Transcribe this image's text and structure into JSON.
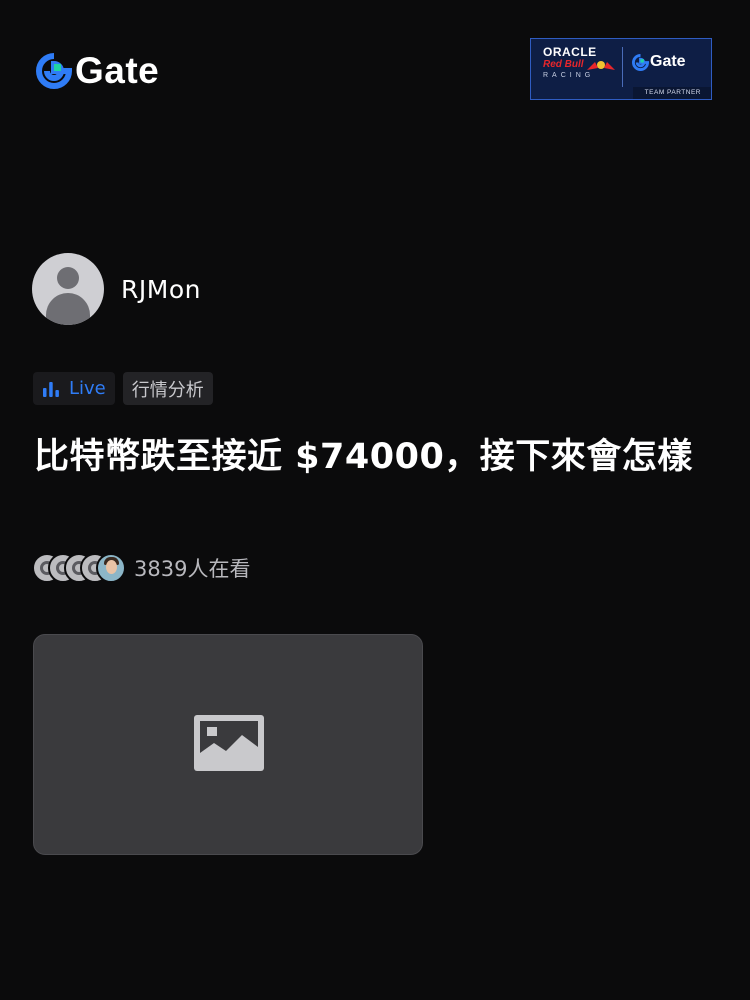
{
  "header": {
    "logo_text": "Gate",
    "brand_color": "#2f7cf6",
    "partner": {
      "line1": "ORACLE",
      "line2": "Red Bull",
      "line3": "RACING",
      "gate_text": "Gate",
      "footer": "TEAM PARTNER"
    }
  },
  "author": {
    "name": "RJMon",
    "avatar_icon": "default-user-avatar"
  },
  "tags": {
    "live_label": "Live",
    "live_icon": "bar-chart-icon",
    "topic_label": "行情分析"
  },
  "title": "比特幣跌至接近 $74000，接下來會怎樣",
  "viewers": {
    "count_text": "3839人在看"
  },
  "media": {
    "icon": "image-placeholder-icon"
  }
}
